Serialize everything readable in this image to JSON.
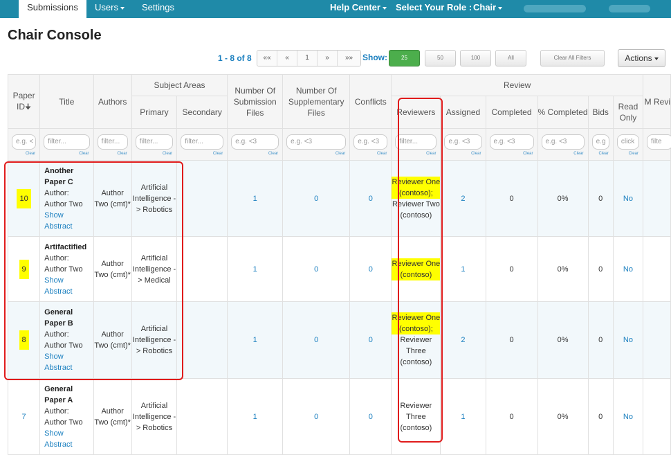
{
  "nav": {
    "submissions": "Submissions",
    "users": "Users",
    "settings": "Settings",
    "help_center": "Help Center",
    "select_role_label": "Select Your Role :",
    "role": "Chair"
  },
  "page": {
    "title": "Chair Console"
  },
  "toolbar": {
    "count": "1 - 8 of 8",
    "pager": [
      "««",
      "«",
      "1",
      "»",
      "»»"
    ],
    "show_label": "Show:",
    "page_sizes": [
      "25",
      "50",
      "100",
      "All"
    ],
    "clear_all": "Clear All Filters",
    "actions": "Actions"
  },
  "headers": {
    "paper_id": "Paper ID",
    "title": "Title",
    "authors": "Authors",
    "subject_areas": "Subject Areas",
    "primary": "Primary",
    "secondary": "Secondary",
    "num_submission_files": "Number Of Submission Files",
    "num_supplementary_files": "Number Of Supplementary Files",
    "conflicts": "Conflicts",
    "review": "Review",
    "reviewers": "Reviewers",
    "assigned": "Assigned",
    "completed": "Completed",
    "pct_completed": "% Completed",
    "bids": "Bids",
    "read_only": "Read Only",
    "more": "M Revi"
  },
  "filters": {
    "paper_id": "e.g. <",
    "title": "filter...",
    "authors": "filter...",
    "primary": "filter...",
    "secondary": "filter...",
    "sub_files": "e.g. <3",
    "supp_files": "e.g. <3",
    "conflicts": "e.g. <3",
    "reviewers": "filter...",
    "assigned": "e.g. <3",
    "completed": "e.g. <3",
    "pct": "e.g. <3",
    "bids": "e.g",
    "read_only": "click",
    "more": "filte",
    "clear": "Clear"
  },
  "paper_meta": {
    "author_label": "Author:",
    "author_name": "Author Two",
    "show": "Show",
    "abstract": "Abstract"
  },
  "rows": [
    {
      "id": "10",
      "title": "Another Paper C",
      "authors": "Author Two (cmt)*",
      "primary": "Artificial Intelligence -> Robotics",
      "sub_files": "1",
      "supp_files": "0",
      "conflicts": "0",
      "reviewer_highlight": "Reviewer One (contoso);",
      "reviewer_plain": "Reviewer Two (contoso)",
      "assigned": "2",
      "completed": "0",
      "pct": "0%",
      "bids": "0",
      "read_only": "No"
    },
    {
      "id": "9",
      "title": "Artifactified",
      "authors": "Author Two (cmt)*",
      "primary": "Artificial Intelligence -> Medical",
      "sub_files": "1",
      "supp_files": "0",
      "conflicts": "0",
      "reviewer_highlight": "Reviewer One (contoso)",
      "reviewer_plain": "",
      "assigned": "1",
      "completed": "0",
      "pct": "0%",
      "bids": "0",
      "read_only": "No"
    },
    {
      "id": "8",
      "title": "General Paper B",
      "authors": "Author Two (cmt)*",
      "primary": "Artificial Intelligence -> Robotics",
      "sub_files": "1",
      "supp_files": "0",
      "conflicts": "0",
      "reviewer_highlight": "Reviewer One (contoso);",
      "reviewer_plain": "Reviewer Three (contoso)",
      "assigned": "2",
      "completed": "0",
      "pct": "0%",
      "bids": "0",
      "read_only": "No"
    },
    {
      "id": "7",
      "title": "General Paper A",
      "authors": "Author Two (cmt)*",
      "primary": "Artificial Intelligence -> Robotics",
      "sub_files": "1",
      "supp_files": "0",
      "conflicts": "0",
      "reviewer_highlight": "",
      "reviewer_plain": "Reviewer Three (contoso)",
      "assigned": "1",
      "completed": "0",
      "pct": "0%",
      "bids": "0",
      "read_only": "No"
    }
  ],
  "colors": {
    "nav": "#1f8aa8",
    "link": "#1a7fbf",
    "highlight": "#ffff00",
    "annotation": "#e01b1b",
    "green": "#4cae4c"
  }
}
